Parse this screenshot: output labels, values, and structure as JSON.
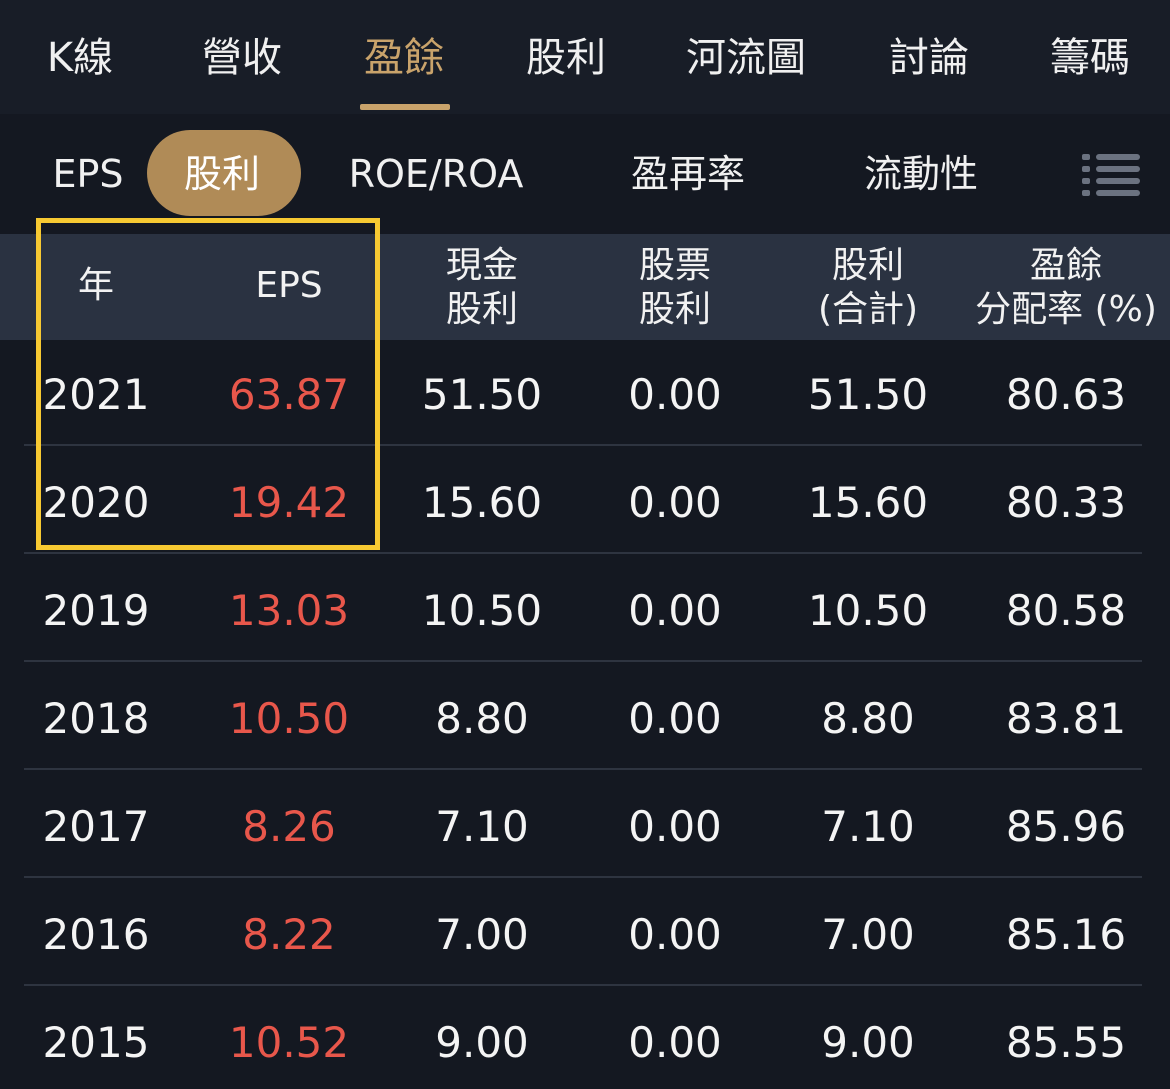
{
  "top_tabs": [
    {
      "label": "K線",
      "active": false
    },
    {
      "label": "營收",
      "active": false
    },
    {
      "label": "盈餘",
      "active": true
    },
    {
      "label": "股利",
      "active": false
    },
    {
      "label": "河流圖",
      "active": false
    },
    {
      "label": "討論",
      "active": false
    },
    {
      "label": "籌碼",
      "active": false
    }
  ],
  "sub_tabs": [
    {
      "label": "EPS",
      "active": false
    },
    {
      "label": "股利",
      "active": true
    },
    {
      "label": "ROE/ROA",
      "active": false
    },
    {
      "label": "盈再率",
      "active": false
    },
    {
      "label": "流動性",
      "active": false
    }
  ],
  "menu_icon": "list-menu-icon",
  "colors": {
    "accent": "#c9a36b",
    "pill": "#b08b57",
    "eps_red": "#e8574b",
    "highlight": "#f7c932",
    "header_bg": "#2a3241",
    "background": "#141821"
  },
  "table": {
    "headers": {
      "year": "年",
      "eps": "EPS",
      "cash_dividend": [
        "現金",
        "股利"
      ],
      "stock_dividend": [
        "股票",
        "股利"
      ],
      "total_dividend": [
        "股利",
        "(合計)"
      ],
      "payout_ratio": [
        "盈餘",
        "分配率 (%)"
      ]
    },
    "rows": [
      {
        "year": "2021",
        "eps": "63.87",
        "cash": "51.50",
        "stock": "0.00",
        "total": "51.50",
        "payout": "80.63"
      },
      {
        "year": "2020",
        "eps": "19.42",
        "cash": "15.60",
        "stock": "0.00",
        "total": "15.60",
        "payout": "80.33"
      },
      {
        "year": "2019",
        "eps": "13.03",
        "cash": "10.50",
        "stock": "0.00",
        "total": "10.50",
        "payout": "80.58"
      },
      {
        "year": "2018",
        "eps": "10.50",
        "cash": "8.80",
        "stock": "0.00",
        "total": "8.80",
        "payout": "83.81"
      },
      {
        "year": "2017",
        "eps": "8.26",
        "cash": "7.10",
        "stock": "0.00",
        "total": "7.10",
        "payout": "85.96"
      },
      {
        "year": "2016",
        "eps": "8.22",
        "cash": "7.00",
        "stock": "0.00",
        "total": "7.00",
        "payout": "85.16"
      },
      {
        "year": "2015",
        "eps": "10.52",
        "cash": "9.00",
        "stock": "0.00",
        "total": "9.00",
        "payout": "85.55"
      }
    ]
  }
}
